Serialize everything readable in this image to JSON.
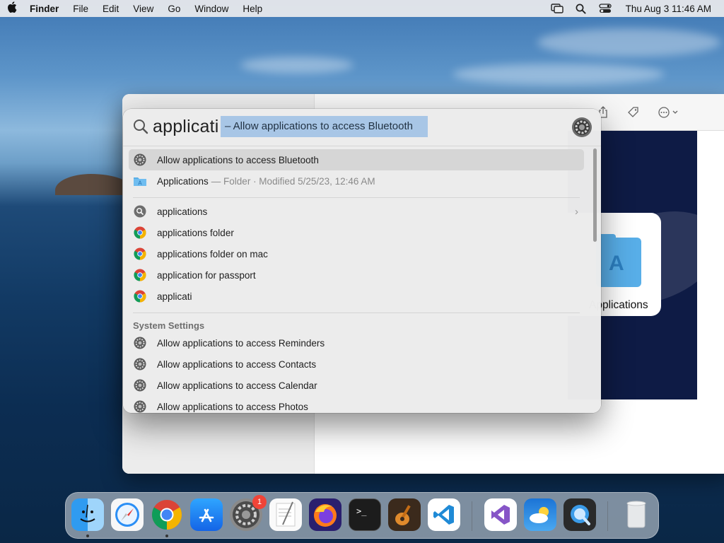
{
  "menubar": {
    "apple_icon": "apple-logo-icon",
    "app_name": "Finder",
    "menus": [
      "File",
      "Edit",
      "View",
      "Go",
      "Window",
      "Help"
    ],
    "status_icons": [
      "screen-mirroring-icon",
      "search-icon",
      "control-center-icon"
    ],
    "clock": "Thu Aug 3  11:46 AM"
  },
  "finder": {
    "icon_label": "Applications"
  },
  "spotlight": {
    "query": "applicati",
    "completion": "– Allow applications to access Bluetooth",
    "top_hits": [
      {
        "label": "Allow applications to access Bluetooth",
        "meta": "",
        "icon": "system-settings-icon",
        "selected": true
      },
      {
        "label": "Applications",
        "meta": "— Folder · Modified 5/25/23, 12:46 AM",
        "icon": "folder-icon",
        "selected": false
      }
    ],
    "suggestions": [
      {
        "label": "applications",
        "icon": "search-suggestion-icon",
        "chevron": true
      },
      {
        "label": "applications folder",
        "icon": "chrome-icon",
        "chevron": false
      },
      {
        "label": "applications folder on mac",
        "icon": "chrome-icon",
        "chevron": false
      },
      {
        "label": "application for passport",
        "icon": "chrome-icon",
        "chevron": false
      },
      {
        "label": "applicati",
        "icon": "chrome-icon",
        "chevron": false
      }
    ],
    "section_title": "System Settings",
    "system_settings": [
      "Allow applications to access Reminders",
      "Allow applications to access Contacts",
      "Allow applications to access Calendar",
      "Allow applications to access Photos"
    ]
  },
  "dock": {
    "apps": [
      {
        "name": "Finder",
        "icon": "finder-icon",
        "running": true
      },
      {
        "name": "Safari",
        "icon": "safari-icon",
        "running": false
      },
      {
        "name": "Google Chrome",
        "icon": "chrome-icon",
        "running": true
      },
      {
        "name": "App Store",
        "icon": "app-store-icon",
        "running": false
      },
      {
        "name": "System Settings",
        "icon": "system-settings-icon",
        "running": false,
        "badge": "1"
      },
      {
        "name": "TextEdit",
        "icon": "textedit-icon",
        "running": false
      },
      {
        "name": "Firefox",
        "icon": "firefox-icon",
        "running": false
      },
      {
        "name": "Terminal",
        "icon": "terminal-icon",
        "running": false
      },
      {
        "name": "GarageBand",
        "icon": "garageband-icon",
        "running": false
      },
      {
        "name": "Visual Studio Code",
        "icon": "vscode-icon",
        "running": false
      },
      {
        "name": "Visual Studio",
        "icon": "visual-studio-icon",
        "running": false
      },
      {
        "name": "Weather",
        "icon": "weather-icon",
        "running": false
      },
      {
        "name": "QuickTime Player",
        "icon": "quicktime-icon",
        "running": false
      },
      {
        "name": "Trash",
        "icon": "trash-icon",
        "running": false
      }
    ]
  }
}
